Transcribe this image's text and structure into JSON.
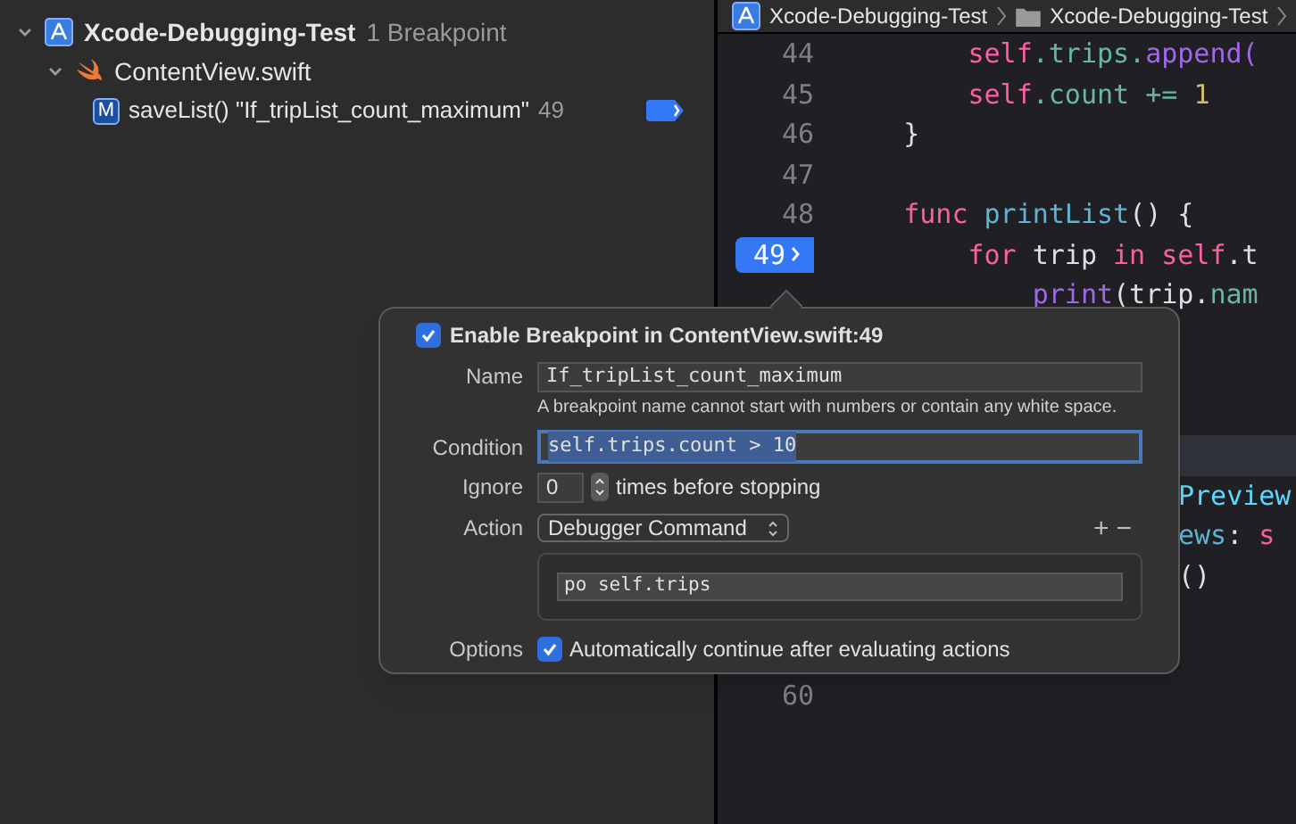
{
  "navigator": {
    "project": {
      "name": "Xcode-Debugging-Test",
      "count": "1 Breakpoint",
      "expanded": true
    },
    "file": {
      "name": "ContentView.swift",
      "expanded": true
    },
    "breakpoint": {
      "badge": "M",
      "label": "saveList() \"If_tripList_count_maximum\"",
      "line": "49",
      "enabled": true
    }
  },
  "breadcrumb": [
    "Xcode-Debugging-Test",
    "Xcode-Debugging-Test"
  ],
  "editor": {
    "lines": [
      {
        "kind": "code",
        "number": "44",
        "tokens": [
          {
            "text": "        self",
            "color": "#fc5fa3"
          },
          {
            "text": ".trips.",
            "color": "#67b7a4"
          },
          {
            "text": "append(",
            "color": "#a167e6"
          }
        ]
      },
      {
        "kind": "code",
        "number": "45",
        "tokens": [
          {
            "text": "        self",
            "color": "#fc5fa3"
          },
          {
            "text": ".count += ",
            "color": "#67b7a4"
          },
          {
            "text": "1",
            "color": "#d0bf69"
          }
        ]
      },
      {
        "kind": "code",
        "number": "46",
        "tokens": [
          {
            "text": "    }",
            "color": "#dfdfe0"
          }
        ]
      },
      {
        "kind": "blank",
        "number": "47"
      },
      {
        "kind": "code",
        "number": "48",
        "tokens": [
          {
            "text": "    func ",
            "color": "#fc5fa3"
          },
          {
            "text": "printList",
            "color": "#5fb4d3"
          },
          {
            "text": "() {",
            "color": "#dfdfe0"
          }
        ]
      },
      {
        "kind": "code",
        "number": "49",
        "breakpoint": true,
        "tokens": [
          {
            "text": "        for ",
            "color": "#fc5fa3"
          },
          {
            "text": "trip ",
            "color": "#dfdfe0"
          },
          {
            "text": "in ",
            "color": "#fc5fa3"
          },
          {
            "text": "self",
            "color": "#fc5fa3"
          },
          {
            "text": ".t",
            "color": "#dfdfe0"
          }
        ]
      },
      {
        "kind": "code",
        "tokens": [
          {
            "text": "            print",
            "color": "#a167e6"
          },
          {
            "text": "(trip.",
            "color": "#dfdfe0"
          },
          {
            "text": "nam",
            "color": "#67b7a4"
          }
        ]
      },
      {
        "kind": "blank"
      },
      {
        "kind": "blank"
      },
      {
        "kind": "blank"
      },
      {
        "kind": "blank",
        "highlighted": true
      },
      {
        "kind": "code",
        "covered": true,
        "tokens": [
          {
            "text": "Preview",
            "color": "#5dd8ff"
          }
        ]
      },
      {
        "kind": "code",
        "covered": true,
        "tokens": [
          {
            "text": "ews",
            "color": "#5fb4d3"
          },
          {
            "text": ": ",
            "color": "#dfdfe0"
          },
          {
            "text": "s",
            "color": "#fc5fa3"
          }
        ]
      },
      {
        "kind": "code",
        "covered": true,
        "tokens": [
          {
            "text": "()",
            "color": "#dfdfe0"
          }
        ]
      },
      {
        "kind": "blank"
      },
      {
        "kind": "blank"
      },
      {
        "kind": "blank",
        "number": "60"
      }
    ]
  },
  "popover": {
    "enabled": true,
    "title": "Enable Breakpoint in ContentView.swift:49",
    "name_label": "Name",
    "name_value": "If_tripList_count_maximum",
    "name_hint": "A breakpoint name cannot start with numbers or contain any white space.",
    "condition_label": "Condition",
    "condition_value": "self.trips.count > 10",
    "ignore_label": "Ignore",
    "ignore_value": "0",
    "ignore_suffix": "times before stopping",
    "action_label": "Action",
    "action_value": "Debugger Command",
    "add": "+",
    "remove": "−",
    "command": "po self.trips",
    "options_label": "Options",
    "auto_continue": true,
    "auto_continue_label": "Automatically continue after evaluating actions"
  }
}
